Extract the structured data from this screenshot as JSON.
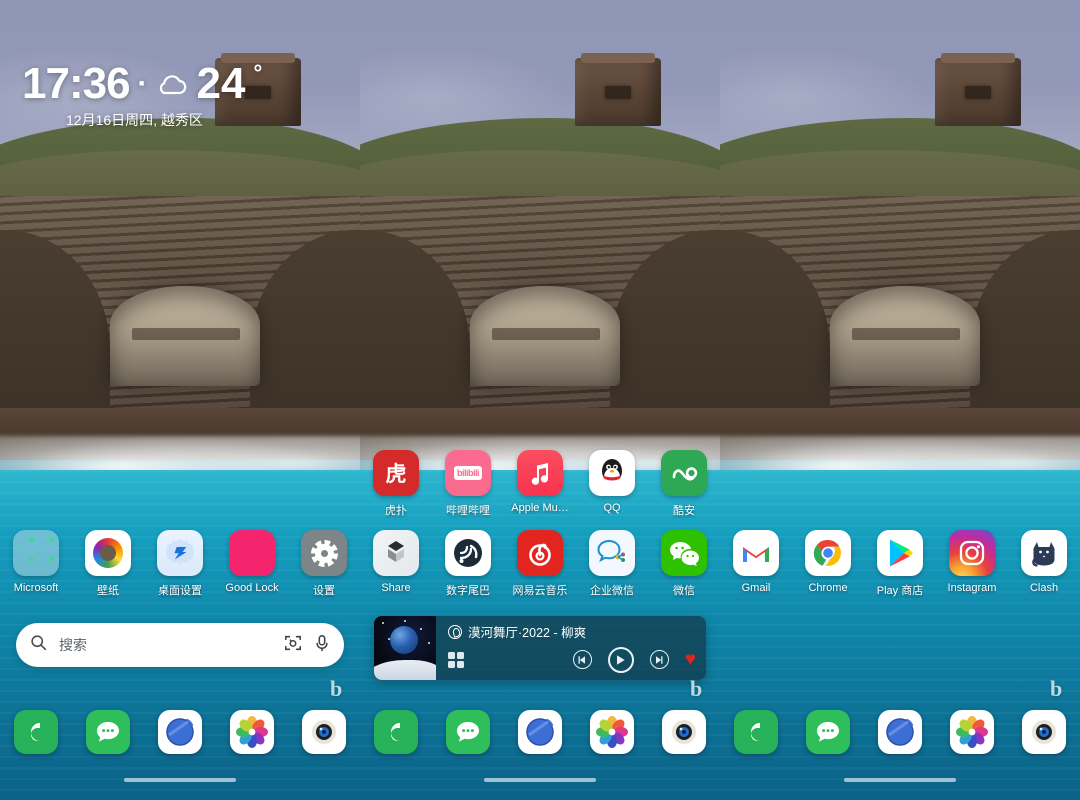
{
  "meta": {
    "device": "Android home screen",
    "panel_count": 3
  },
  "colors": {
    "sea": "#12a0c0",
    "sky": "#9096b6",
    "accent_pink": "#f4256c",
    "heart_red": "#e02424",
    "netease_red": "#e2261f",
    "wechat_green": "#2dc100"
  },
  "clock_widget": {
    "time": "17:36",
    "separator": "·",
    "weather_icon": "cloud-icon",
    "temperature": "24",
    "degree": "°",
    "date_line": "12月16日周四, 越秀区"
  },
  "panels": [
    {
      "id": "panel-1",
      "rows": [
        {
          "name": "app-row-1",
          "apps": [
            {
              "label": "Microsoft",
              "icon": "microsoft-folder-icon"
            },
            {
              "label": "壁纸",
              "icon": "wallpaper-icon"
            },
            {
              "label": "桌面设置",
              "icon": "desktop-settings-icon"
            },
            {
              "label": "Good Lock",
              "icon": "good-lock-icon"
            },
            {
              "label": "设置",
              "icon": "settings-gear-icon"
            }
          ]
        }
      ],
      "search": {
        "placeholder": "搜索",
        "search_icon": "search-icon",
        "lens_icon": "lens-icon",
        "mic_icon": "microphone-icon",
        "brand_mark": "b"
      }
    },
    {
      "id": "panel-2",
      "rows": [
        {
          "name": "app-row-1",
          "apps": [
            {
              "label": "虎扑",
              "icon": "hupu-icon"
            },
            {
              "label": "哔哩哔哩",
              "icon": "bilibili-icon",
              "icon_text": "bilibili"
            },
            {
              "label": "Apple Mu…",
              "icon": "apple-music-icon"
            },
            {
              "label": "QQ",
              "icon": "qq-penguin-icon"
            },
            {
              "label": "酷安",
              "icon": "coolapk-icon"
            }
          ]
        },
        {
          "name": "app-row-2",
          "apps": [
            {
              "label": "Share",
              "icon": "share-icon"
            },
            {
              "label": "数字尾巴",
              "icon": "dgtle-icon"
            },
            {
              "label": "网易云音乐",
              "icon": "netease-music-icon"
            },
            {
              "label": "企业微信",
              "icon": "wecom-icon"
            },
            {
              "label": "微信",
              "icon": "wechat-icon"
            }
          ]
        }
      ],
      "music_widget": {
        "track_title": "漠河舞厅·2022 - 柳爽",
        "source_icon": "netease-music-icon",
        "playlist_icon": "grid-icon",
        "prev_icon": "previous-track-icon",
        "play_icon": "play-icon",
        "next_icon": "next-track-icon",
        "like_icon": "heart-filled-icon",
        "album_art": "earth-over-moon-artwork"
      },
      "brand_mark": "b"
    },
    {
      "id": "panel-3",
      "rows": [
        {
          "name": "app-row-1",
          "apps": [
            {
              "label": "Gmail",
              "icon": "gmail-icon"
            },
            {
              "label": "Chrome",
              "icon": "chrome-icon"
            },
            {
              "label": "Play 商店",
              "icon": "play-store-icon"
            },
            {
              "label": "Instagram",
              "icon": "instagram-icon"
            },
            {
              "label": "Clash",
              "icon": "clash-cat-icon"
            }
          ]
        }
      ],
      "brand_mark": "b"
    }
  ],
  "dock": {
    "items": [
      {
        "label": "phone",
        "icon": "phone-icon"
      },
      {
        "label": "messages",
        "icon": "message-bubble-icon"
      },
      {
        "label": "browser",
        "icon": "browser-globe-icon"
      },
      {
        "label": "gallery",
        "icon": "gallery-flower-icon"
      },
      {
        "label": "camera",
        "icon": "camera-lens-icon"
      }
    ]
  },
  "home_indicator": "home-indicator-bar"
}
